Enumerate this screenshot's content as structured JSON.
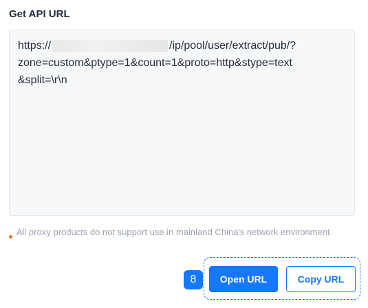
{
  "section": {
    "title": "Get API URL"
  },
  "api_url": {
    "prefix": "https://",
    "suffix": "/ip/pool/user/extract/pub/?",
    "line2": "zone=custom&ptype=1&count=1&proto=http&stype=text",
    "line3": "&split=\\r\\n"
  },
  "notice": {
    "text": "All proxy products do not support use in mainland China's network environment",
    "dot_color": "#f56c2d"
  },
  "step_badge": "8",
  "buttons": {
    "open_url": "Open URL",
    "copy_url": "Copy URL"
  },
  "colors": {
    "accent": "#1677ff"
  }
}
